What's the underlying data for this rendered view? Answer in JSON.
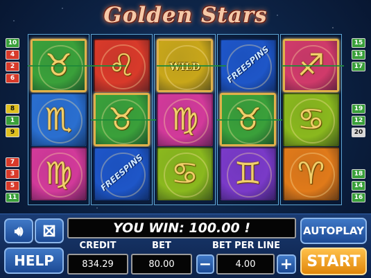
{
  "game": {
    "title": "Golden Stars"
  },
  "reels": [
    [
      {
        "symbol": "taurus",
        "glyph": "♉",
        "color": "#3aa03a",
        "highlight": true
      },
      {
        "symbol": "scorpio",
        "glyph": "♏",
        "color": "#2a6fd0",
        "highlight": false
      },
      {
        "symbol": "virgo",
        "glyph": "♍",
        "color": "#d23a9a",
        "highlight": false
      }
    ],
    [
      {
        "symbol": "leo",
        "glyph": "♌",
        "color": "#d83a2a",
        "highlight": false
      },
      {
        "symbol": "taurus",
        "glyph": "♉",
        "color": "#3aa03a",
        "highlight": true
      },
      {
        "symbol": "freespins",
        "text": "FREESPINS",
        "color": "#1e56c8",
        "highlight": false
      }
    ],
    [
      {
        "symbol": "wild",
        "text": "WILD",
        "color": "#c8a61a",
        "highlight": true
      },
      {
        "symbol": "virgo",
        "glyph": "♍",
        "color": "#d23a9a",
        "highlight": false
      },
      {
        "symbol": "cancer",
        "glyph": "♋",
        "color": "#8ab81e",
        "highlight": false
      }
    ],
    [
      {
        "symbol": "freespins",
        "text": "FREESPINS",
        "color": "#1e56c8",
        "highlight": false
      },
      {
        "symbol": "taurus",
        "glyph": "♉",
        "color": "#3aa03a",
        "highlight": true
      },
      {
        "symbol": "gemini",
        "glyph": "♊",
        "color": "#7a3ac8",
        "highlight": false
      }
    ],
    [
      {
        "symbol": "sagittarius",
        "glyph": "♐",
        "color": "#d03a6a",
        "highlight": true
      },
      {
        "symbol": "cancer",
        "glyph": "♋",
        "color": "#8ab81e",
        "highlight": false
      },
      {
        "symbol": "aries",
        "glyph": "♈",
        "color": "#e07a1a",
        "highlight": false
      }
    ]
  ],
  "line_badges": {
    "left": [
      {
        "n": "10",
        "color": "#3aa03a"
      },
      {
        "n": "4",
        "color": "#d83a2a"
      },
      {
        "n": "2",
        "color": "#d83a2a"
      },
      {
        "n": "6",
        "color": "#d83a2a"
      },
      {
        "n": "8",
        "color": "#e0c020"
      },
      {
        "n": "1",
        "color": "#3aa03a"
      },
      {
        "n": "9",
        "color": "#e0c020"
      },
      {
        "n": "7",
        "color": "#d83a2a"
      },
      {
        "n": "3",
        "color": "#d83a2a"
      },
      {
        "n": "5",
        "color": "#d83a2a"
      },
      {
        "n": "11",
        "color": "#3aa03a"
      }
    ],
    "right": [
      {
        "n": "15",
        "color": "#3aa03a"
      },
      {
        "n": "13",
        "color": "#3aa03a"
      },
      {
        "n": "17",
        "color": "#3aa03a"
      },
      {
        "n": "19",
        "color": "#3aa03a"
      },
      {
        "n": "12",
        "color": "#3aa03a"
      },
      {
        "n": "20",
        "color": "#d9d9d9"
      },
      {
        "n": "18",
        "color": "#3aa03a"
      },
      {
        "n": "14",
        "color": "#3aa03a"
      },
      {
        "n": "16",
        "color": "#3aa03a"
      }
    ]
  },
  "win_message": "YOU WIN: 100.00 !",
  "controls": {
    "sound_icon": "speaker-icon",
    "fullscreen_icon": "fullscreen-arrows-icon",
    "help_label": "HELP",
    "autoplay_label": "AUTOPLAY",
    "start_label": "START",
    "minus_label": "−",
    "plus_label": "+"
  },
  "meters": {
    "credit_label": "CREDIT",
    "credit_value": "834.29",
    "bet_label": "BET",
    "bet_value": "80.00",
    "bet_per_line_label": "BET PER LINE",
    "bet_per_line_value": "4.00"
  },
  "colors": {
    "start_button": "#f2a21c",
    "win_line": "#1f8a3a",
    "reel_border": "#5fa7d6"
  }
}
